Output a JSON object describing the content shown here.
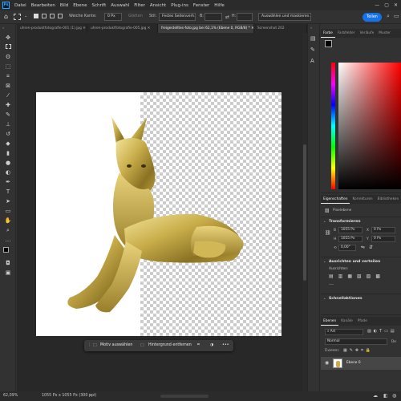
{
  "app": {
    "logo": "Ps"
  },
  "menu": [
    "Datei",
    "Bearbeiten",
    "Bild",
    "Ebene",
    "Schrift",
    "Auswahl",
    "Filter",
    "Ansicht",
    "Plug-ins",
    "Fenster",
    "Hilfe"
  ],
  "window_controls": [
    "—",
    "▢",
    "✕"
  ],
  "options": {
    "feather_label": "Weiche Kante:",
    "feather_value": "0 Px",
    "smooth_label": "Glätten",
    "style_label": "Stil:",
    "style_value": "Festes Seitenverh...",
    "width_label": "B:",
    "height_label": "H:",
    "select_mask_button": "Auswählen und maskieren...",
    "share_button": "Teilen"
  },
  "tabs": [
    {
      "label": "uhren-produktfotografie-001 (1).jpg",
      "active": false
    },
    {
      "label": "uhren-produktfotografie-005.jpg",
      "active": false
    },
    {
      "label": "freigestelltes-foto.jpg bei 62,1% (Ebene 0, RGB/8) *",
      "active": true
    },
    {
      "label": "Screenshot 202",
      "active": false
    }
  ],
  "taskbar": {
    "select_subject": "Motiv auswählen",
    "remove_background": "Hintergrund entfernen",
    "more": "•••"
  },
  "status": {
    "zoom": "62,09%",
    "dims": "1055 Px x 1055 Px (300 ppi)"
  },
  "color_panel": {
    "tabs": [
      "Farbe",
      "Farbfelder",
      "Verläufe",
      "Muster"
    ]
  },
  "properties_panel": {
    "tabs": [
      "Eigenschaften",
      "Korrekturen",
      "Bibliotheken"
    ],
    "pixel_layer": "Pixelebene",
    "transform_title": "Transformieren",
    "w_label": "B",
    "w_value": "1055 Px",
    "x_label": "X",
    "x_value": "0 Px",
    "h_label": "H",
    "h_value": "1055 Px",
    "y_label": "Y",
    "y_value": "0 Px",
    "angle_value": "0,00°",
    "align_title": "Ausrichten und verteilen",
    "align_label": "Ausrichten:",
    "quick_actions_title": "Schnellaktionen"
  },
  "layers_panel": {
    "tabs": [
      "Ebenen",
      "Kanäle",
      "Pfade"
    ],
    "filter_value": "Art",
    "blend_mode": "Normal",
    "opacity_label": "De",
    "lock_label": "Fixieren:",
    "layer_name": "Ebene 0"
  },
  "colors": {
    "accent": "#1473e6",
    "bg": "#323232",
    "canvas_bg": "#282828"
  }
}
